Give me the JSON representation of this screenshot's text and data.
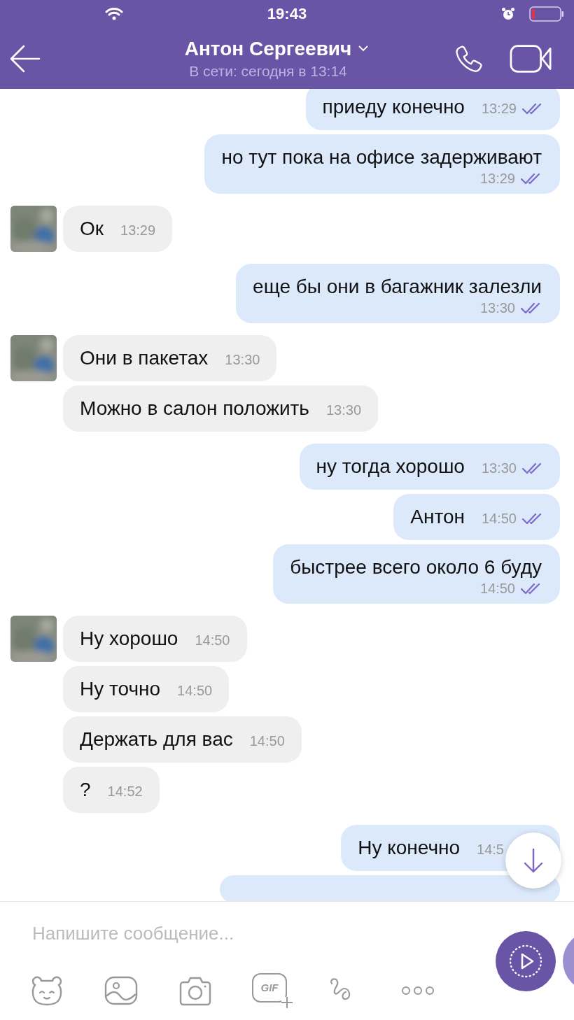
{
  "status_bar": {
    "time": "19:43"
  },
  "header": {
    "title": "Антон Сергеевич",
    "subtitle": "В сети: сегодня в 13:14"
  },
  "messages": [
    {
      "kind": "sent",
      "text": "приеду конечно",
      "time": "13:29",
      "read": true
    },
    {
      "kind": "sent-long",
      "text": "но тут пока на офисе задерживают",
      "time": "13:29",
      "read": true
    },
    {
      "kind": "received",
      "text": "Ок",
      "time": "13:29"
    },
    {
      "kind": "sent-long",
      "text": "еще бы они в багажник залезли",
      "time": "13:30",
      "read": true
    },
    {
      "kind": "received",
      "text": "Они в пакетах",
      "time": "13:30"
    },
    {
      "kind": "received",
      "text": "Можно в салон положить",
      "time": "13:30"
    },
    {
      "kind": "sent",
      "text": "ну тогда хорошо",
      "time": "13:30",
      "read": true
    },
    {
      "kind": "sent",
      "text": "Антон",
      "time": "14:50",
      "read": true
    },
    {
      "kind": "sent-long",
      "text": "быстрее всего около 6 буду",
      "time": "14:50",
      "read": true
    },
    {
      "kind": "received",
      "text": "Ну хорошо",
      "time": "14:50"
    },
    {
      "kind": "received",
      "text": "Ну точно",
      "time": "14:50"
    },
    {
      "kind": "received",
      "text": "Держать для вас",
      "time": "14:50"
    },
    {
      "kind": "received",
      "text": "?",
      "time": "14:52"
    },
    {
      "kind": "sent",
      "text": "Ну конечно",
      "time": "14:5"
    }
  ],
  "composer": {
    "placeholder": "Напишите сообщение...",
    "gif_label": "GIF"
  }
}
